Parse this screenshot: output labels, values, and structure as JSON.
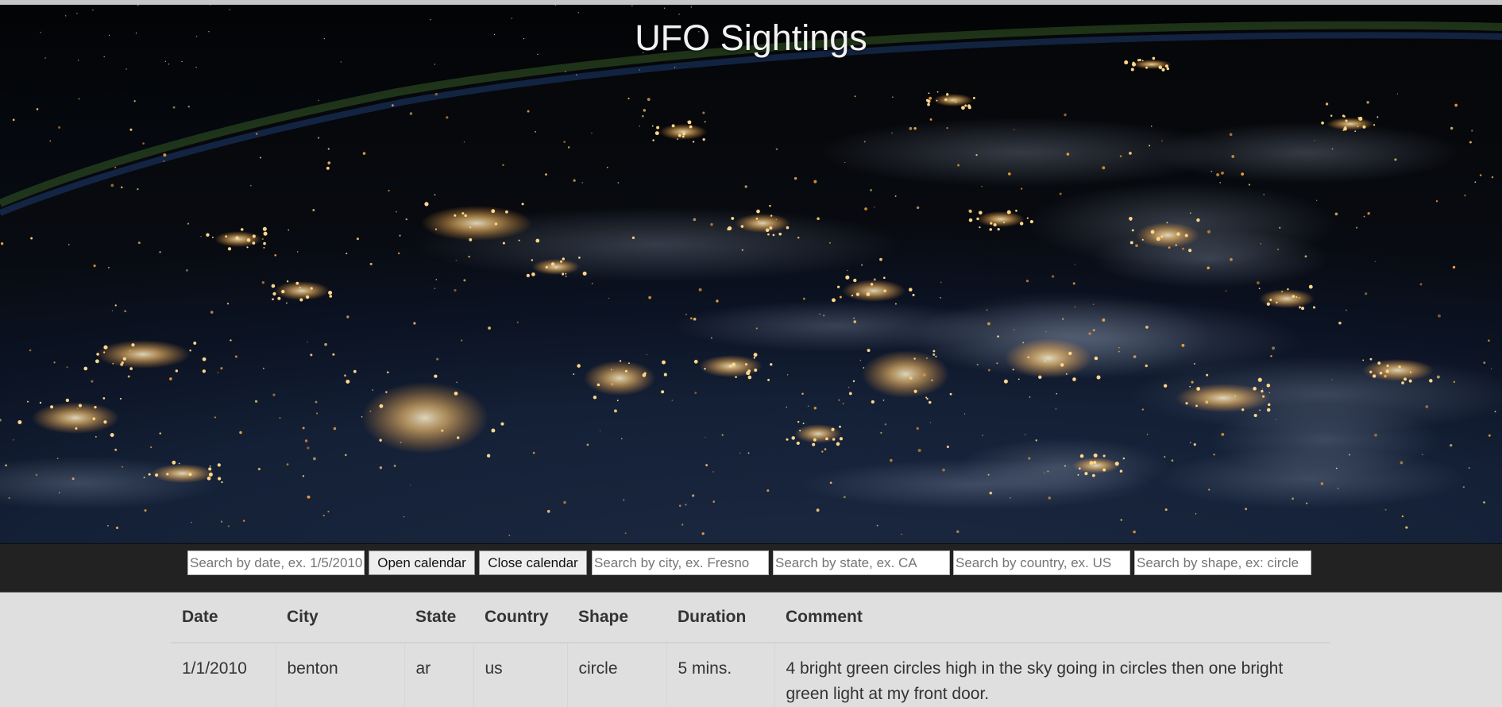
{
  "hero": {
    "title": "UFO Sightings"
  },
  "toolbar": {
    "date_search": {
      "placeholder": "Search by date, ex. 1/5/2010"
    },
    "open_calendar_label": "Open calendar",
    "close_calendar_label": "Close calendar",
    "city_search": {
      "placeholder": "Search by city, ex. Fresno"
    },
    "state_search": {
      "placeholder": "Search by state, ex. CA"
    },
    "country_search": {
      "placeholder": "Search by country, ex. US"
    },
    "shape_search": {
      "placeholder": "Search by shape, ex: circle"
    }
  },
  "table": {
    "headers": [
      "Date",
      "City",
      "State",
      "Country",
      "Shape",
      "Duration",
      "Comment"
    ],
    "rows": [
      [
        "1/1/2010",
        "benton",
        "ar",
        "us",
        "circle",
        "5 mins.",
        "4 bright green circles high in the sky going in circles then one bright green light at my front door."
      ]
    ]
  },
  "colors": {
    "toolbar_background": "#222222",
    "page_background": "#dfdfdf",
    "table_text": "#333333",
    "title_text": "#f2f2f2",
    "city_light": "#ffc870"
  }
}
